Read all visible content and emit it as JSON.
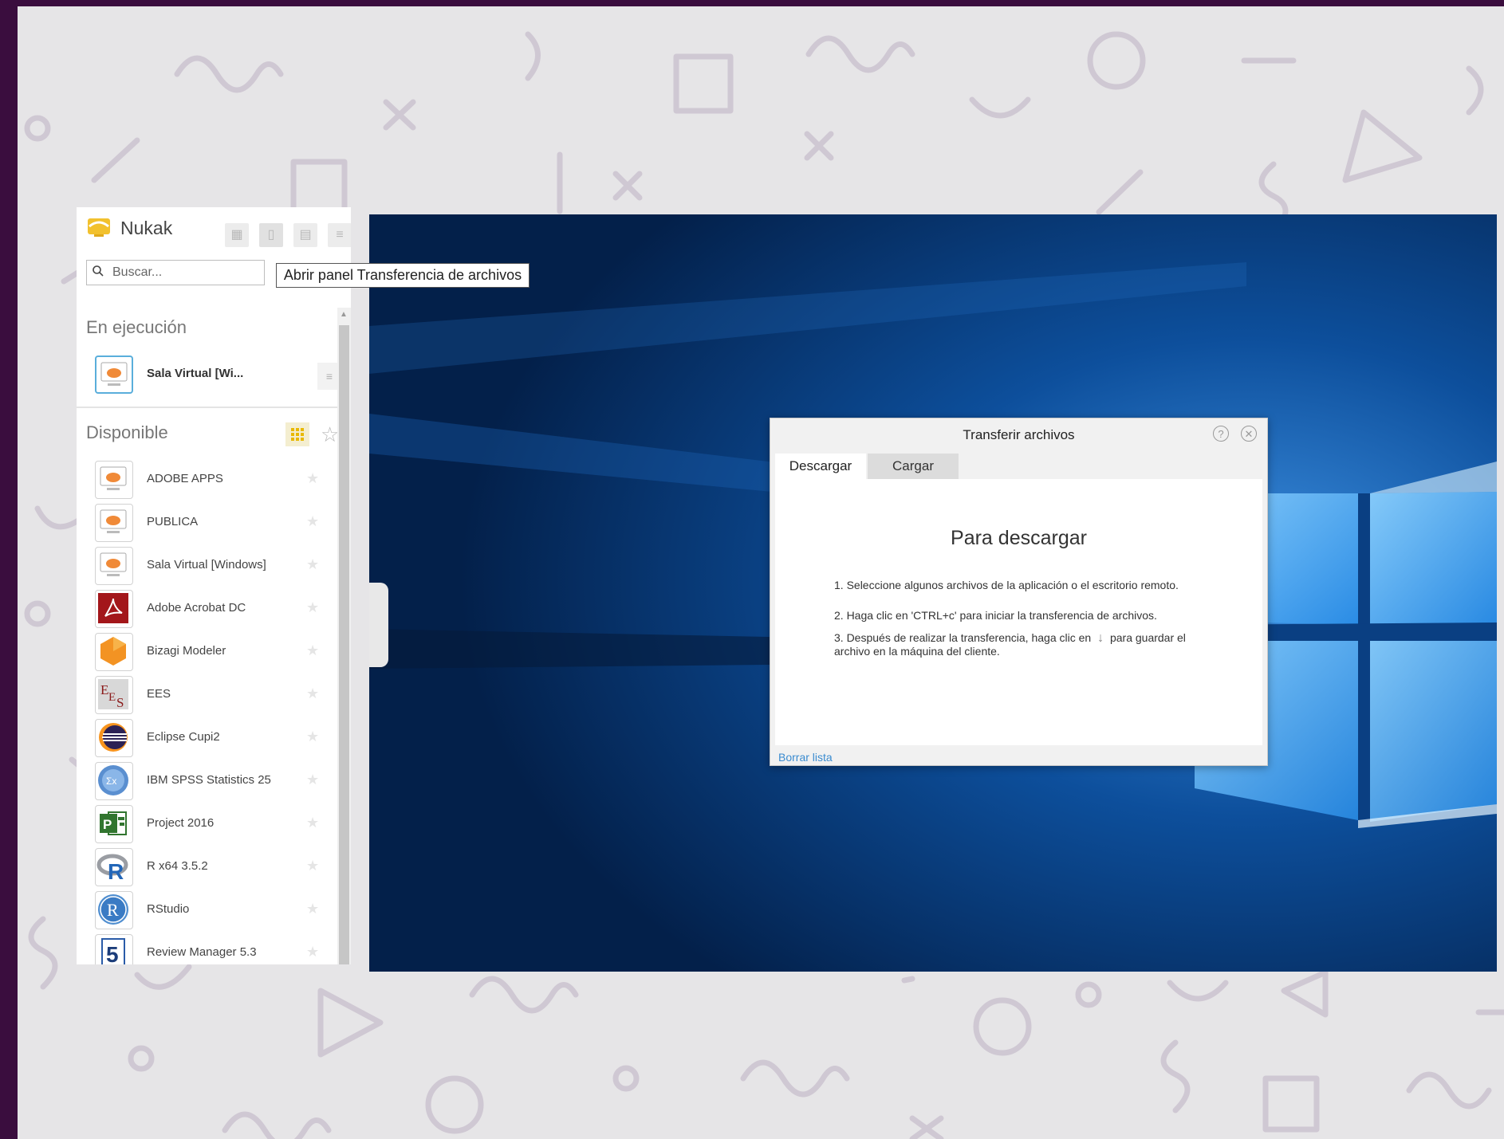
{
  "app": {
    "title": "Nukak"
  },
  "search": {
    "placeholder": "Buscar..."
  },
  "tooltip": {
    "text": "Abrir panel Transferencia de archivos"
  },
  "running": {
    "title": "En ejecución",
    "item": {
      "label": "Sala Virtual [Wi...",
      "icon": "cloud-desktop-icon"
    }
  },
  "available": {
    "title": "Disponible",
    "items": [
      {
        "label": "ADOBE APPS",
        "icon": "cloud-desktop-icon"
      },
      {
        "label": "PUBLICA",
        "icon": "cloud-desktop-icon"
      },
      {
        "label": "Sala Virtual [Windows]",
        "icon": "cloud-desktop-icon"
      },
      {
        "label": "Adobe Acrobat DC",
        "icon": "acrobat-icon"
      },
      {
        "label": "Bizagi Modeler",
        "icon": "bizagi-icon"
      },
      {
        "label": "EES",
        "icon": "ees-icon"
      },
      {
        "label": "Eclipse Cupi2",
        "icon": "eclipse-icon"
      },
      {
        "label": "IBM SPSS Statistics 25",
        "icon": "spss-icon"
      },
      {
        "label": "Project 2016",
        "icon": "project-icon"
      },
      {
        "label": "R x64 3.5.2",
        "icon": "r-icon"
      },
      {
        "label": "RStudio",
        "icon": "rstudio-icon"
      },
      {
        "label": "Review Manager 5.3",
        "icon": "revman-icon"
      }
    ]
  },
  "dialog": {
    "title": "Transferir archivos",
    "tabs": {
      "download": "Descargar",
      "upload": "Cargar"
    },
    "heading": "Para descargar",
    "step1": "1. Seleccione algunos archivos de la aplicación o el escritorio remoto.",
    "step2": "2. Haga clic en 'CTRL+c' para iniciar la transferencia de archivos.",
    "step3_before": "3. Después de realizar la transferencia, haga clic en",
    "step3_after": "para guardar el archivo en la máquina del cliente.",
    "clear_list": "Borrar lista"
  },
  "colors": {
    "background": "#e6e5e7",
    "desktop": "#083a74",
    "accent": "#3b8cd0",
    "frame": "#3a0d3e"
  }
}
